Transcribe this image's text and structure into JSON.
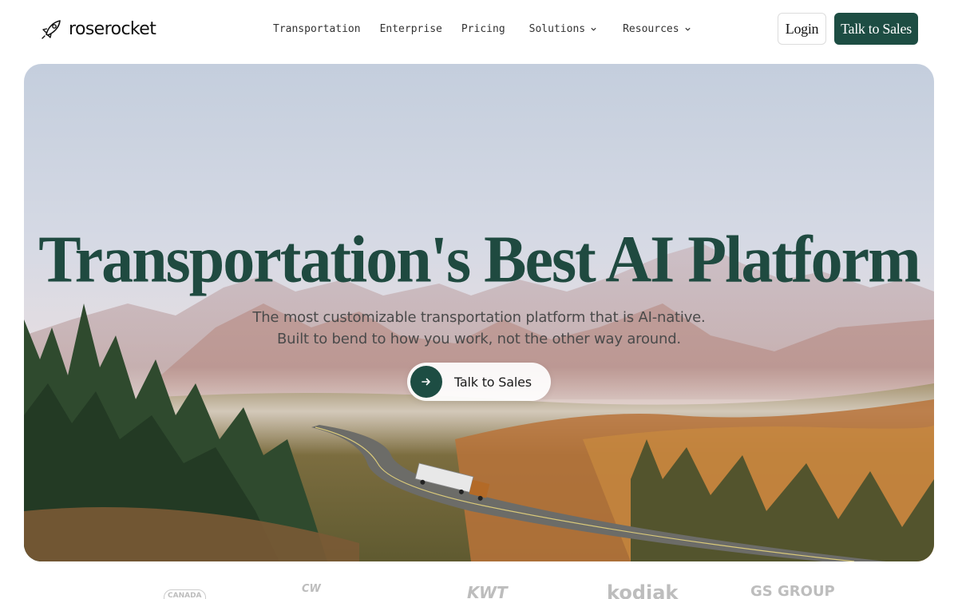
{
  "header": {
    "brand": "roserocket",
    "nav": [
      {
        "label": "Transportation"
      },
      {
        "label": "Enterprise"
      },
      {
        "label": "Pricing"
      },
      {
        "label": "Solutions"
      },
      {
        "label": "Resources"
      }
    ],
    "login_label": "Login",
    "sales_label": "Talk to Sales"
  },
  "hero": {
    "title": "Transportation's Best AI Platform",
    "subtitle_line1": "The most customizable transportation platform that is AI-native.",
    "subtitle_line2": "Built to bend to how you work, not the other way around.",
    "cta_label": "Talk to Sales"
  },
  "customer_logos": [
    "CANADA",
    "CW",
    "KWT",
    "kodiak",
    "GS GROUP"
  ],
  "colors": {
    "brand_green": "#1d4d43",
    "title_green": "#1f4a40"
  }
}
